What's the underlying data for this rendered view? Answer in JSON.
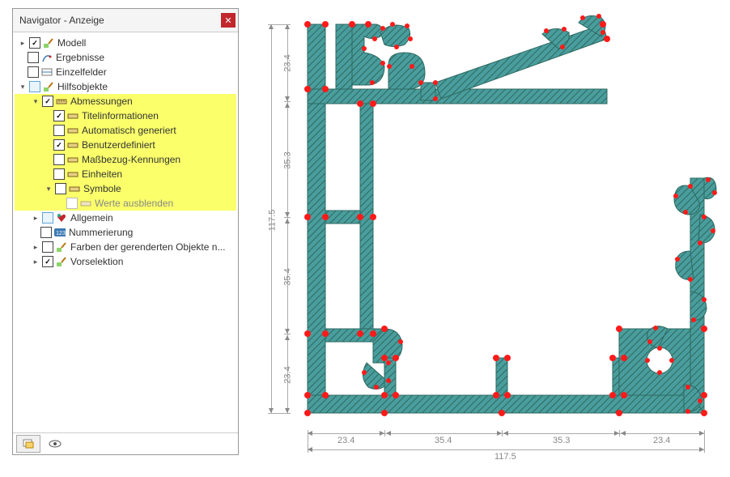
{
  "panel": {
    "title": "Navigator - Anzeige",
    "close_glyph": "✕"
  },
  "tree": {
    "modell": "Modell",
    "ergebnisse": "Ergebnisse",
    "einzelfelder": "Einzelfelder",
    "hilfsobjekte": "Hilfsobjekte",
    "abmessungen": "Abmessungen",
    "titelinformationen": "Titelinformationen",
    "automatisch": "Automatisch generiert",
    "benutzerdefiniert": "Benutzerdefiniert",
    "massbezug": "Maßbezug-Kennungen",
    "einheiten": "Einheiten",
    "symbole": "Symbole",
    "werte_ausblenden": "Werte ausblenden",
    "allgemein": "Allgemein",
    "nummerierung": "Nummerierung",
    "farben": "Farben der gerenderten Objekte n...",
    "vorselektion": "Vorselektion"
  },
  "icons": {
    "brush_green": "🖌",
    "folder": "📁",
    "ruler": "📏",
    "numbering": "123",
    "heart": "❤",
    "eye": "👁",
    "panel": "▭"
  },
  "dimensions": {
    "v1": "23.4",
    "v2": "35.3",
    "v3": "35.4",
    "v4": "23.4",
    "vtotal": "117.5",
    "h1": "23.4",
    "h2": "35.4",
    "h3": "35.3",
    "h4": "23.4",
    "htotal": "117.5"
  },
  "colors": {
    "profile_fill": "#3d8a8a",
    "hatch": "#2f6e6e",
    "nodes": "#ff1a1a",
    "highlight": "#faff6a",
    "dim": "#888888"
  }
}
